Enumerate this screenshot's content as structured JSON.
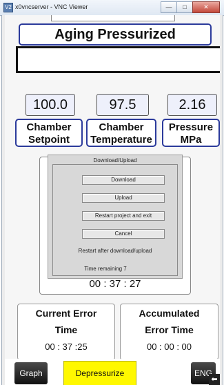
{
  "window": {
    "logo_text": "V2",
    "title": "x0vncserver - VNC Viewer",
    "minimize": "—",
    "maximize": "□",
    "close": "✕"
  },
  "hmi": {
    "status_title": "Aging Pressurized",
    "message": "",
    "values": {
      "chamber_setpoint": "100.0",
      "chamber_temperature": "97.5",
      "pressure_mpa": "2.16"
    },
    "labels": {
      "setpoint_line1": "Chamber",
      "setpoint_line2": "Setpoint",
      "temperature_line1": "Chamber",
      "temperature_line2": "Temperature",
      "pressure_line1": "Pressure",
      "pressure_line2": "MPa"
    },
    "timer_value": "00 : 37 : 27",
    "current_error": {
      "line1": "Current Error",
      "line2": "Time",
      "value": "00 : 37 :25"
    },
    "accumulated_error": {
      "line1": "Accumulated",
      "line2": "Error Time",
      "value": "00 : 00 : 00"
    },
    "buttons": {
      "graph": "Graph",
      "depressurize": "Depressurize",
      "eng": "ENG"
    }
  },
  "dialog": {
    "title": "Download/Upload",
    "download": "Download",
    "upload": "Upload",
    "restart_exit": "Restart project and exit",
    "cancel": "Cancel",
    "restart_note": "Restart after download/upload",
    "time_remaining": "Time remaining 7"
  }
}
